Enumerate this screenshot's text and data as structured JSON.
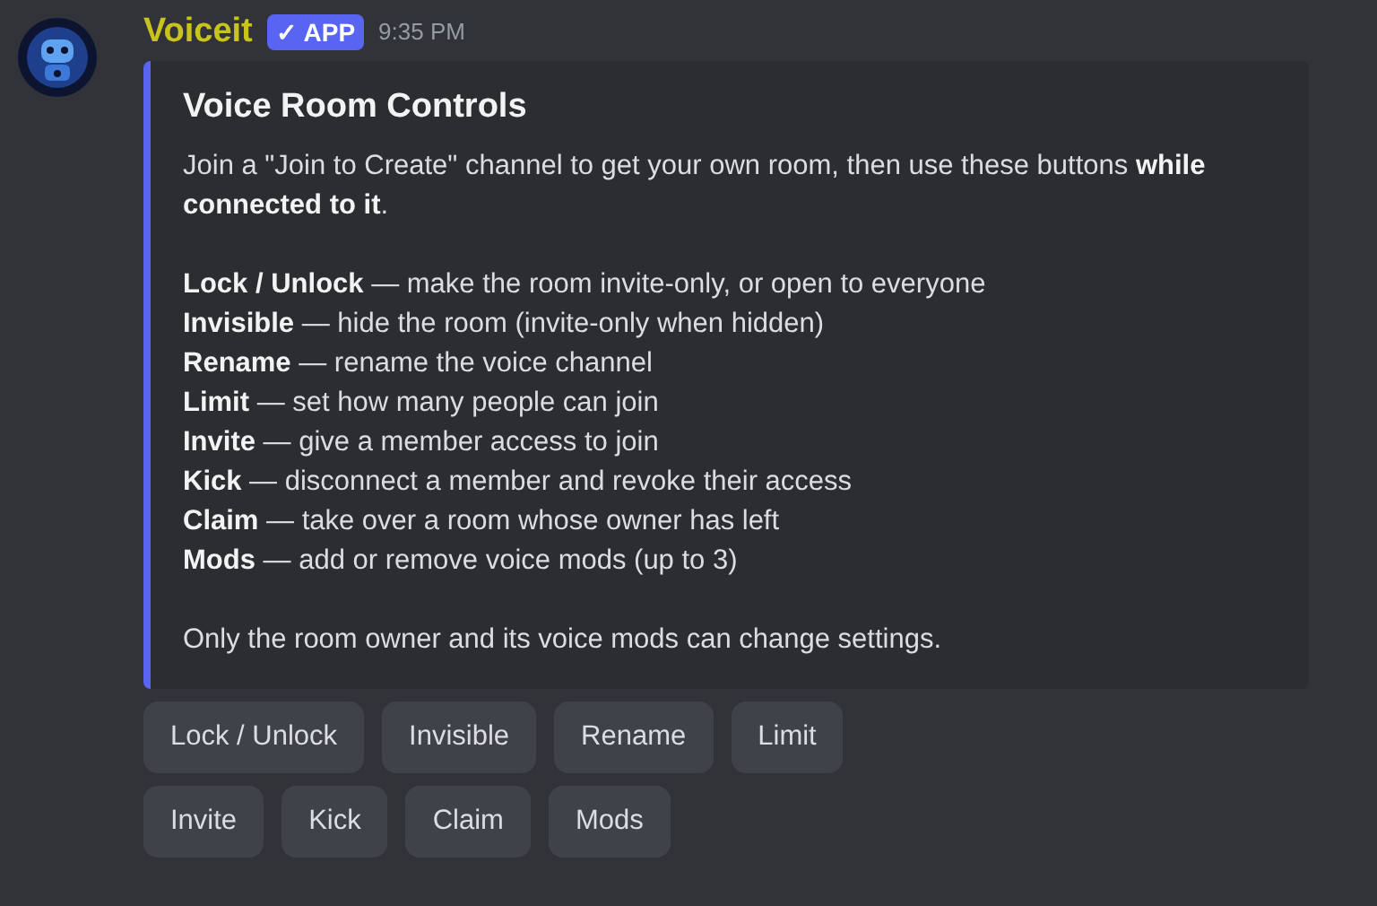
{
  "message": {
    "author": "Voiceit",
    "badge": {
      "check": "✓",
      "label": "APP"
    },
    "time": "9:35 PM"
  },
  "embed": {
    "title": "Voice Room Controls",
    "intro": "Join a \"Join to Create\" channel to get your own room, then use these buttons **while connected to it**.",
    "commands": [
      "**Lock / Unlock** — make the room invite-only, or open to everyone",
      "**Invisible** — hide the room (invite-only when hidden)",
      "**Rename** — rename the voice channel",
      "**Limit** — set how many people can join",
      "**Invite** — give a member access to join",
      "**Kick** — disconnect a member and revoke their access",
      "**Claim** — take over a room whose owner has left",
      "**Mods** — add or remove voice mods (up to 3)"
    ],
    "footer": "Only the room owner and its voice mods can change settings."
  },
  "button_rows": [
    [
      "Lock / Unlock",
      "Invisible",
      "Rename",
      "Limit"
    ],
    [
      "Invite",
      "Kick",
      "Claim",
      "Mods"
    ]
  ]
}
